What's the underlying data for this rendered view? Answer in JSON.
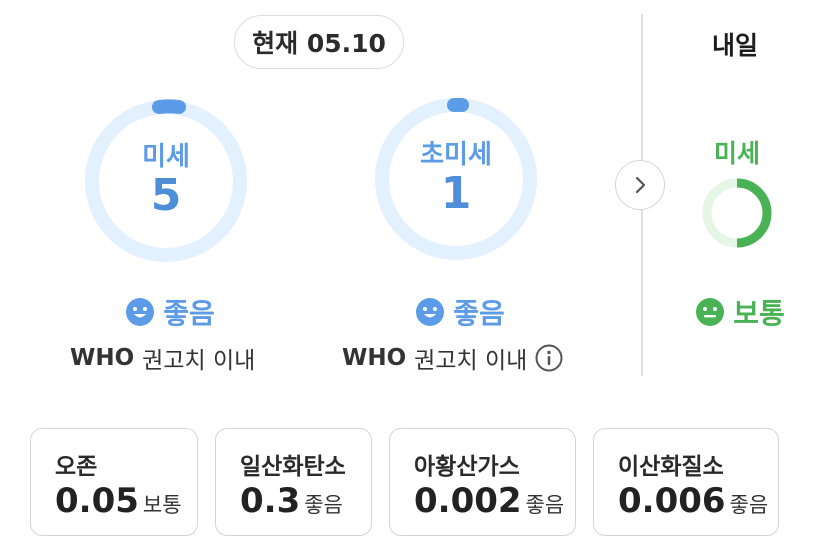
{
  "today": {
    "date_label": "현재 05.10",
    "fine_dust": {
      "label": "미세",
      "value": "5",
      "status": "좋음",
      "note_bold": "WHO",
      "note": "권고치 이내",
      "ring_fraction": 0.05
    },
    "ultra_fine_dust": {
      "label": "초미세",
      "value": "1",
      "status": "좋음",
      "note_bold": "WHO",
      "note": "권고치 이내",
      "ring_fraction": 0.01
    }
  },
  "tomorrow": {
    "title": "내일",
    "fine_dust": {
      "label": "미세",
      "status": "보통",
      "ring_fraction": 0.5
    }
  },
  "colors": {
    "good": "#5b9be8",
    "good_track": "#e3f0fd",
    "normal": "#48b254",
    "normal_track": "#e6f6e6"
  },
  "icons": {
    "next": "chevron-right-icon",
    "info": "info-icon",
    "good_face": "smile-face-icon",
    "normal_face": "neutral-face-icon"
  },
  "pollutants": [
    {
      "name": "오존",
      "value": "0.05",
      "level": "보통"
    },
    {
      "name": "일산화탄소",
      "value": "0.3",
      "level": "좋음"
    },
    {
      "name": "아황산가스",
      "value": "0.002",
      "level": "좋음"
    },
    {
      "name": "이산화질소",
      "value": "0.006",
      "level": "좋음"
    }
  ]
}
